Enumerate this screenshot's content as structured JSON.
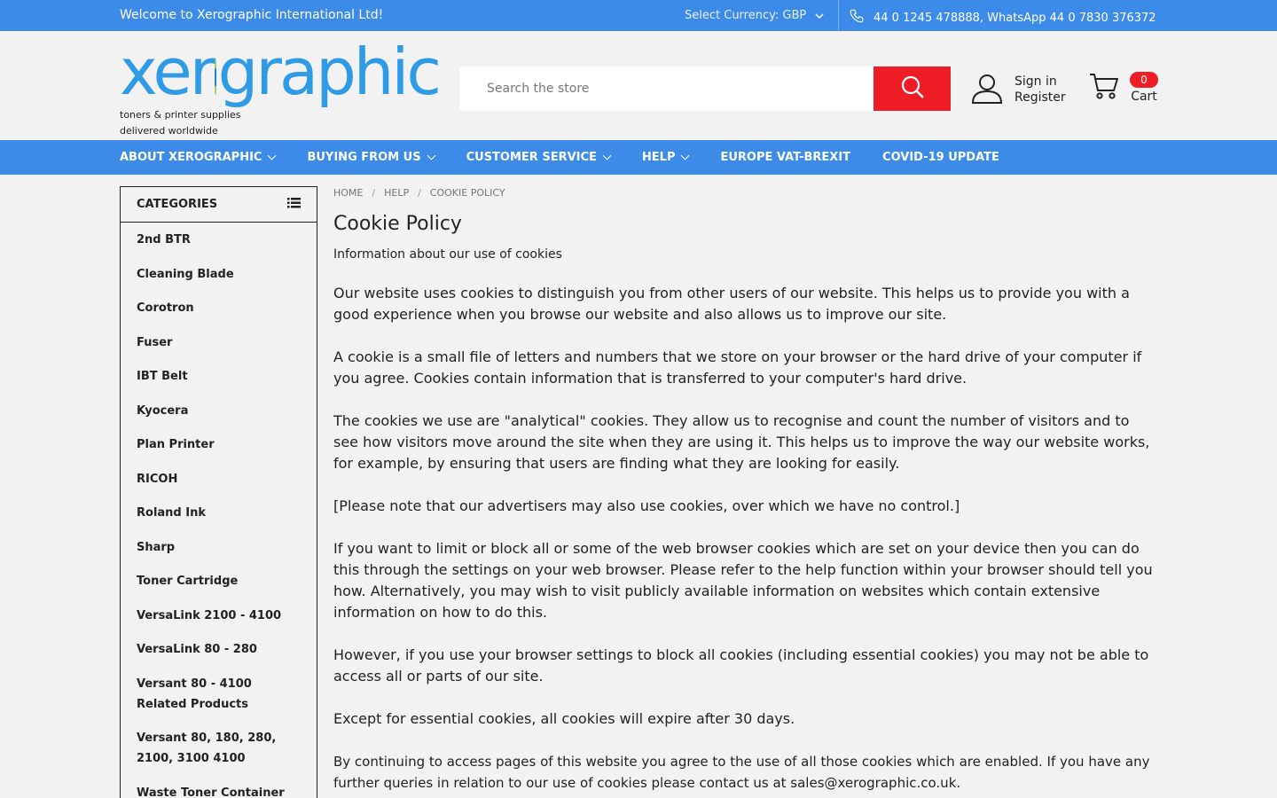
{
  "topbar": {
    "welcome": "Welcome to Xerographic International Ltd!",
    "currency": "Select Currency: GBP",
    "phone": "44 0 1245 478888, WhatsApp 44 0 7830 376372"
  },
  "logo": {
    "word_left": "xer",
    "word_right": "graphic",
    "tagline1": "toners & printer supplies",
    "tagline2": "delivered worldwide"
  },
  "search": {
    "placeholder": "Search the store"
  },
  "account": {
    "sign_in": "Sign in",
    "register": "Register"
  },
  "cart": {
    "label": "Cart",
    "count": "0"
  },
  "nav": {
    "items": [
      {
        "label": "ABOUT XEROGRAPHIC",
        "dropdown": true
      },
      {
        "label": "BUYING FROM US",
        "dropdown": true
      },
      {
        "label": "CUSTOMER SERVICE",
        "dropdown": true
      },
      {
        "label": "HELP",
        "dropdown": true
      },
      {
        "label": "EUROPE VAT-BREXIT",
        "dropdown": false
      },
      {
        "label": "COVID-19 UPDATE",
        "dropdown": false
      }
    ]
  },
  "sidebar": {
    "heading": "CATEGORIES",
    "items": [
      "2nd BTR",
      "Cleaning Blade",
      "Corotron",
      "Fuser",
      "IBT Belt",
      "Kyocera",
      "Plan Printer",
      "RICOH",
      "Roland Ink",
      "Sharp",
      "Toner Cartridge",
      "VersaLink 2100 - 4100",
      "VersaLink 80 - 280",
      "Versant 80 - 4100 Related Products",
      "Versant 80, 180, 280, 2100, 3100 4100",
      "Waste Toner Container"
    ]
  },
  "breadcrumb": {
    "home": "HOME",
    "help": "HELP",
    "current": "COOKIE POLICY"
  },
  "page": {
    "title": "Cookie Policy",
    "intro": "Information about our use of cookies",
    "paragraphs": [
      "Our website uses cookies to distinguish you from other users of our website. This helps us to provide you with a good experience when you browse our website and also allows us to improve our site.",
      "A cookie is a small file of letters and numbers that we store on your browser or the hard drive of your computer if you agree. Cookies contain information that is transferred to your computer's hard drive.",
      "The cookies we use are \"analytical\" cookies. They allow us to recognise and count the number of visitors and to see how visitors move around the site when they are using it. This helps us to improve the way our website works, for example, by ensuring that users are finding what they are looking for easily.",
      "[Please note that our advertisers may also use cookies, over which we have no control.]",
      "If you want to limit or block all or some of the web browser cookies which are set on your device then you can do this through the settings on your web browser.  Please refer to the help function within your browser should tell you how. Alternatively, you may wish to visit publicly available information on websites which contain extensive information on how to do this.",
      "However, if you use your browser settings to block all cookies (including essential cookies) you may not be able to access all or parts of our site.",
      "Except for essential cookies, all cookies will expire after 30 days.",
      "By continuing to access pages of this website you agree to the use of all those cookies which are enabled.  If you have any further queries in relation to our use of cookies please contact us at sales@xerographic.co.uk."
    ]
  },
  "colors": {
    "brand_blue": "#3d8be8",
    "accent_red": "#ee1c24",
    "logo_green": "#8cc63f"
  }
}
